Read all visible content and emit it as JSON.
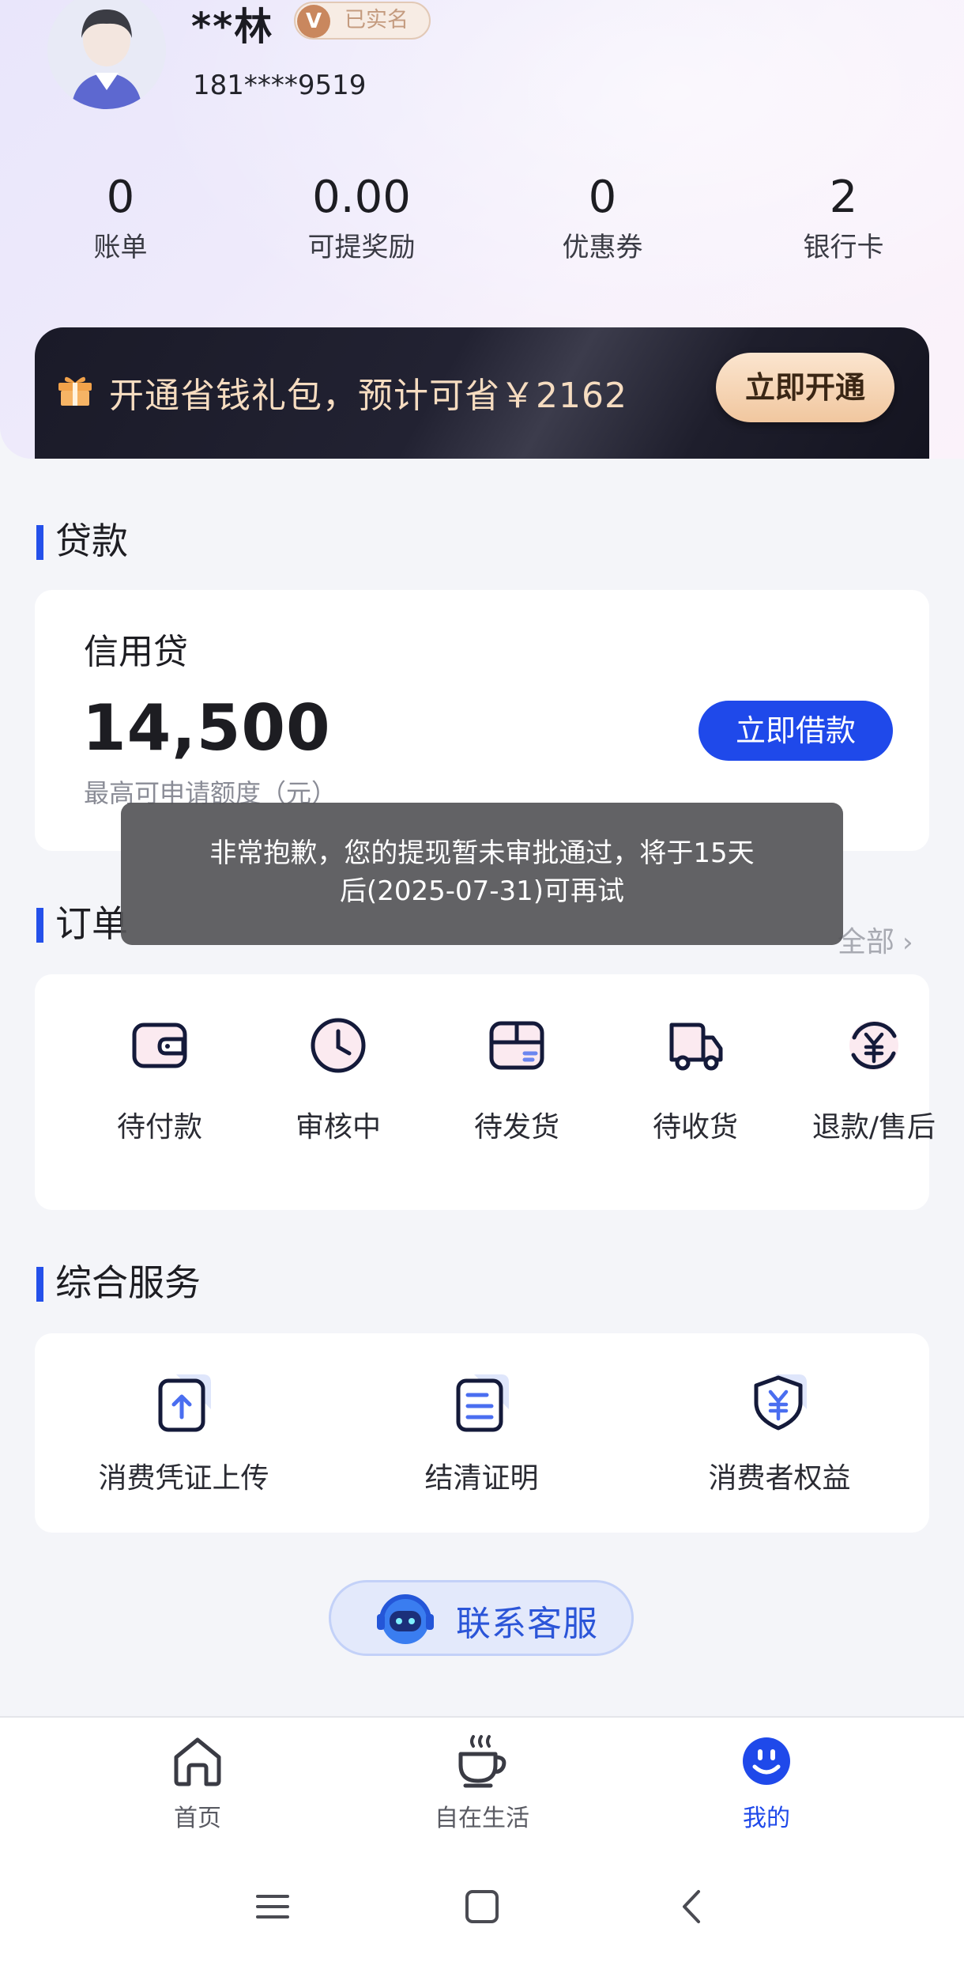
{
  "profile": {
    "name": "**林",
    "verified_badge": "已实名",
    "verified_icon": "v-badge-icon",
    "phone": "181****9519"
  },
  "stats": [
    {
      "value": "0",
      "label": "账单"
    },
    {
      "value": "0.00",
      "label": "可提奖励"
    },
    {
      "value": "0",
      "label": "优惠券"
    },
    {
      "value": "2",
      "label": "银行卡"
    }
  ],
  "promo": {
    "icon": "gift-icon",
    "text": "开通省钱礼包，预计可省￥2162",
    "button": "立即开通"
  },
  "loan": {
    "section_title": "贷款",
    "product_title": "信用贷",
    "amount": "14,500",
    "amount_note": "最高可申请额度（元）",
    "button": "立即借款"
  },
  "orders": {
    "section_title": "订单",
    "view_all": "全部",
    "items": [
      {
        "label": "待付款",
        "icon": "wallet-icon"
      },
      {
        "label": "审核中",
        "icon": "clock-icon"
      },
      {
        "label": "待发货",
        "icon": "package-icon"
      },
      {
        "label": "待收货",
        "icon": "truck-icon"
      },
      {
        "label": "退款/售后",
        "icon": "refund-icon"
      }
    ]
  },
  "services": {
    "section_title": "综合服务",
    "items": [
      {
        "label": "消费凭证上传",
        "icon": "upload-document-icon"
      },
      {
        "label": "结清证明",
        "icon": "certificate-document-icon"
      },
      {
        "label": "消费者权益",
        "icon": "shield-yuan-icon"
      }
    ]
  },
  "customer_service": {
    "label": "联系客服",
    "icon": "robot-agent-icon"
  },
  "toast": {
    "line1": "非常抱歉，您的提现暂未审批通过，将于15天",
    "line2": "后(2025-07-31)可再试"
  },
  "tabbar": {
    "items": [
      {
        "label": "首页",
        "icon": "home-icon",
        "active": false
      },
      {
        "label": "自在生活",
        "icon": "coffee-cup-icon",
        "active": false
      },
      {
        "label": "我的",
        "icon": "smiley-icon",
        "active": true
      }
    ]
  },
  "system_nav": {
    "menu_icon": "menu-icon",
    "home_icon": "square-home-icon",
    "back_icon": "back-chevron-icon"
  },
  "colors": {
    "accent_blue": "#1f49ea",
    "promo_gold": "#f6dcc0",
    "toast_bg": "#555558"
  }
}
